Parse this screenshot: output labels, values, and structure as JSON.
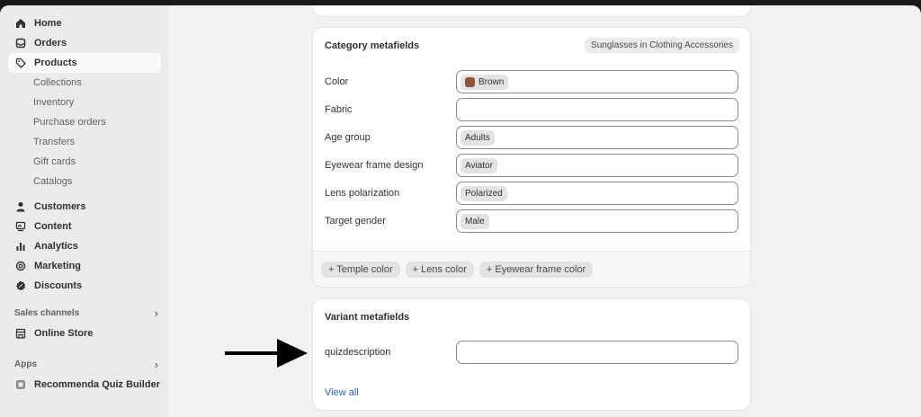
{
  "sidebar": {
    "main_items": [
      {
        "label": "Home",
        "icon": "home-icon"
      },
      {
        "label": "Orders",
        "icon": "inbox-icon"
      },
      {
        "label": "Products",
        "icon": "tag-icon",
        "active": true
      }
    ],
    "product_sub": [
      "Collections",
      "Inventory",
      "Purchase orders",
      "Transfers",
      "Gift cards",
      "Catalogs"
    ],
    "more_items": [
      {
        "label": "Customers",
        "icon": "person-icon"
      },
      {
        "label": "Content",
        "icon": "content-icon"
      },
      {
        "label": "Analytics",
        "icon": "bar-chart-icon"
      },
      {
        "label": "Marketing",
        "icon": "target-icon"
      },
      {
        "label": "Discounts",
        "icon": "discount-icon"
      }
    ],
    "sales_channels": {
      "title": "Sales channels",
      "items": [
        {
          "label": "Online Store",
          "icon": "store-icon"
        }
      ]
    },
    "apps": {
      "title": "Apps",
      "items": [
        {
          "label": "Recommenda Quiz Builder",
          "icon": "app-icon"
        }
      ]
    }
  },
  "category_metafields": {
    "title": "Category metafields",
    "badge": "Sunglasses in Clothing Accessories",
    "rows": [
      {
        "label": "Color",
        "value": "Brown",
        "swatch": "#8e5435"
      },
      {
        "label": "Fabric",
        "value": ""
      },
      {
        "label": "Age group",
        "value": "Adults"
      },
      {
        "label": "Eyewear frame design",
        "value": "Aviator"
      },
      {
        "label": "Lens polarization",
        "value": "Polarized"
      },
      {
        "label": "Target gender",
        "value": "Male"
      }
    ],
    "add_buttons": [
      "+ Temple color",
      "+ Lens color",
      "+ Eyewear frame color"
    ]
  },
  "variant_metafields": {
    "title": "Variant metafields",
    "field_label": "quizdescription",
    "field_value": "",
    "view_all": "View all"
  },
  "colors": {
    "link": "#2463d1",
    "sidebar_bg": "#ebebeb",
    "page_bg": "#f1f1f1"
  }
}
